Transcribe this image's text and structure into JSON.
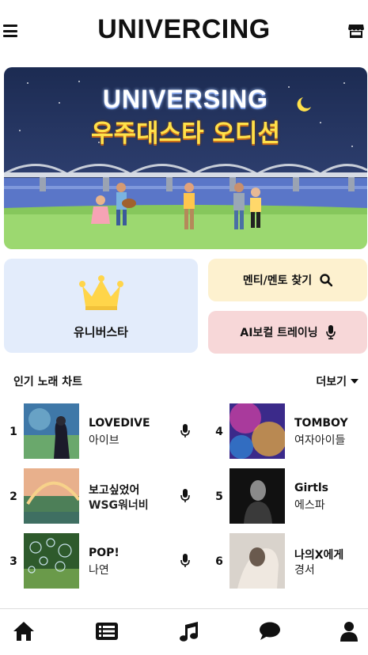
{
  "header": {
    "title": "UNIVERCING",
    "menu_icon": "hamburger-icon",
    "store_icon": "store-icon"
  },
  "banner": {
    "title": "UNIVERSING",
    "subtitle": "우주대스타 오디션"
  },
  "cards": {
    "star_label": "유니버스타",
    "star_icon": "crown-icon",
    "mentor_label": "멘티/멘토 찾기",
    "mentor_icon": "search-icon",
    "ai_label": "AI보컬 트레이닝",
    "ai_icon": "microphone-icon"
  },
  "chart": {
    "heading": "인기 노래 차트",
    "more_label": "더보기",
    "songs": [
      {
        "rank": "1",
        "title": "LOVEDIVE",
        "artist": "아이브",
        "mic": true
      },
      {
        "rank": "2",
        "title": "보고싶었어",
        "artist": "WSG워너비",
        "mic": true
      },
      {
        "rank": "3",
        "title": "POP!",
        "artist": "나연",
        "mic": true
      },
      {
        "rank": "4",
        "title": "TOMBOY",
        "artist": "여자아이들",
        "mic": false
      },
      {
        "rank": "5",
        "title": "Girtls",
        "artist": "에스파",
        "mic": false
      },
      {
        "rank": "6",
        "title": "나의X에게",
        "artist": "경서",
        "mic": false
      }
    ]
  },
  "tabbar": {
    "items": [
      "home-icon",
      "list-icon",
      "music-icon",
      "chat-icon",
      "profile-icon"
    ]
  },
  "colors": {
    "star_card": "#e3ecfb",
    "mentor_card": "#fdf1cf",
    "ai_card": "#f7d7d8",
    "crown": "#ffd54a"
  }
}
